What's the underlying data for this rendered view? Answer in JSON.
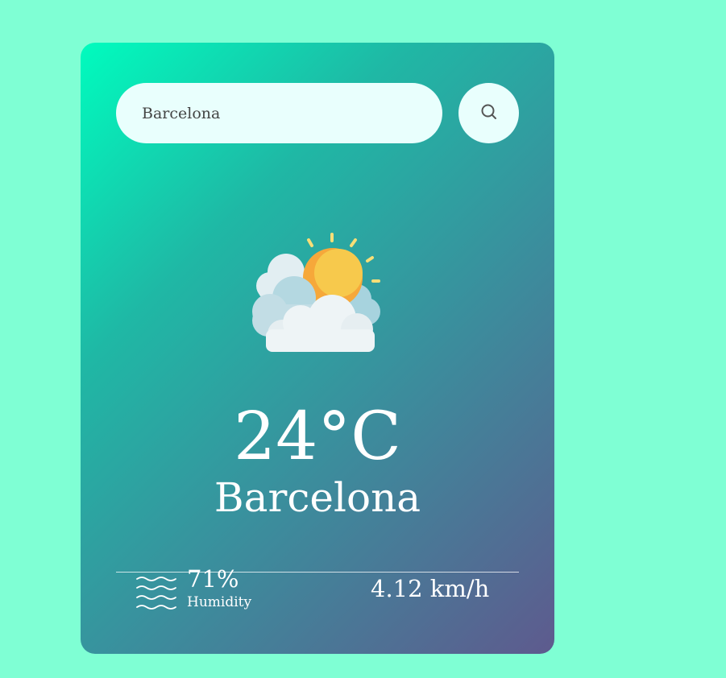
{
  "search": {
    "value": "Barcelona"
  },
  "weather": {
    "icon": "partly-cloudy-icon",
    "temperature": "24°C",
    "city": "Barcelona",
    "humidity_value": "71%",
    "humidity_label": "Humidity",
    "humidity_icon": "waves-icon",
    "wind_value": "4.12 km/h"
  },
  "colors": {
    "page_background": "#7fffd4",
    "card_gradient_start": "#00fcbe",
    "card_gradient_end": "#5e5a8e",
    "input_background": "#e9fffd",
    "text": "#ffffff"
  }
}
